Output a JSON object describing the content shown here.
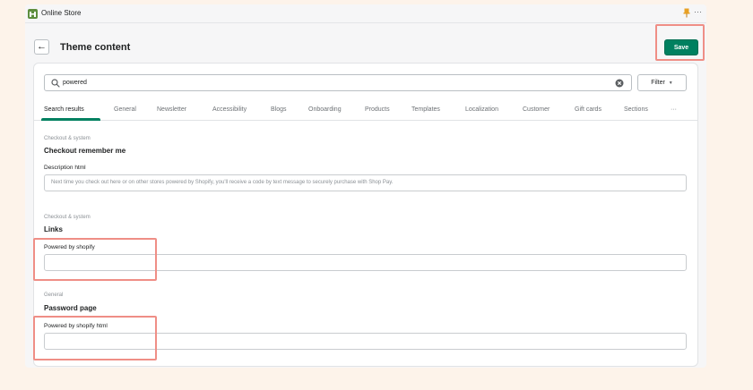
{
  "app": {
    "title": "Online Store",
    "more_label": "···"
  },
  "header": {
    "back_label": "←",
    "title": "Theme content",
    "save_label": "Save"
  },
  "search": {
    "value": "powered",
    "filter_label": "Filter",
    "filter_chevron": "▼"
  },
  "tabs": [
    {
      "label": "Search results",
      "active": true
    },
    {
      "label": "General"
    },
    {
      "label": "Newsletter"
    },
    {
      "label": "Accessibility"
    },
    {
      "label": "Blogs"
    },
    {
      "label": "Onboarding"
    },
    {
      "label": "Products"
    },
    {
      "label": "Templates"
    },
    {
      "label": "Localization"
    },
    {
      "label": "Customer"
    },
    {
      "label": "Gift cards"
    },
    {
      "label": "Sections"
    },
    {
      "label": "···"
    }
  ],
  "sections": [
    {
      "category": "Checkout & system",
      "title": "Checkout remember me",
      "field_label": "Description html",
      "field_value": "Next time you check out here or on other stores powered by Shopify, you'll receive a code by text message to securely purchase with Shop Pay."
    },
    {
      "category": "Checkout & system",
      "title": "Links",
      "field_label": "Powered by shopify",
      "field_value": ""
    },
    {
      "category": "General",
      "title": "Password page",
      "field_label": "Powered by shopify html",
      "field_value": ""
    }
  ],
  "colors": {
    "accent": "#008060",
    "highlight": "#ef8e86",
    "background": "#fdf3ea"
  }
}
